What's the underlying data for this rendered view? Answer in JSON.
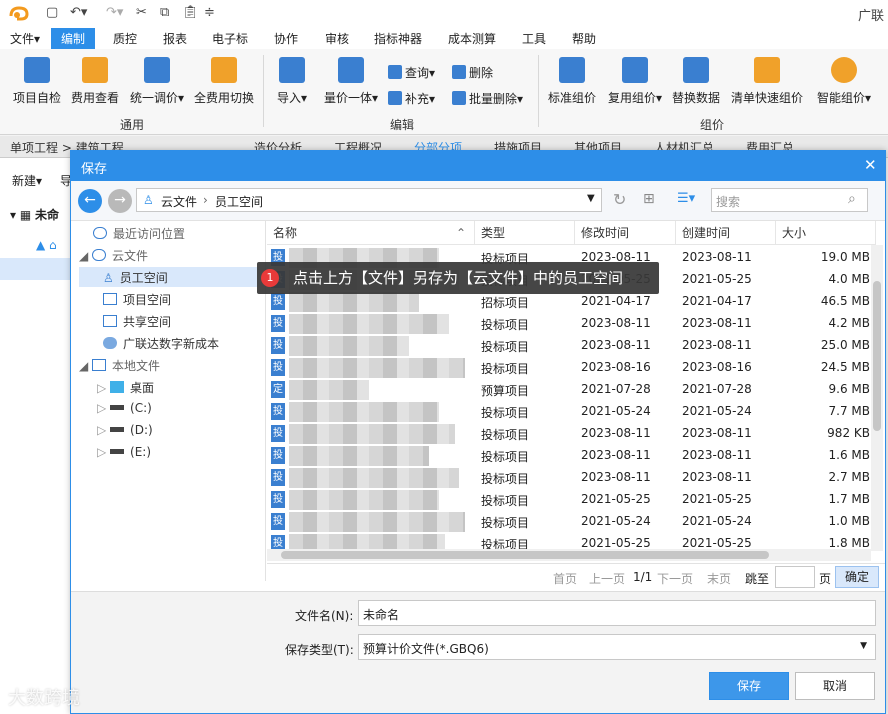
{
  "window": {
    "title_right": "广联达"
  },
  "menubar": [
    "文件",
    "编制",
    "质控",
    "报表",
    "电子标",
    "协作",
    "审核",
    "指标神器",
    "成本测算",
    "工具",
    "帮助"
  ],
  "ribbon": {
    "big_buttons_left": [
      "项目自检",
      "费用查看",
      "统一调价",
      "全费用切换"
    ],
    "big_buttons_mid": [
      "导入",
      "量价一体"
    ],
    "small_buttons": [
      "查询",
      "删除",
      "补充",
      "批量删除"
    ],
    "big_buttons_right": [
      "标准组价",
      "复用组价",
      "替换数据",
      "清单快速组价",
      "智能组价"
    ],
    "groups": [
      "通用",
      "编辑",
      "组价"
    ]
  },
  "background": {
    "tabs": [
      "单项工程",
      "建筑工程",
      "造价分析",
      "工程概况",
      "分部分项",
      "措施项目",
      "其他项目",
      "人材机汇总",
      "费用汇总"
    ],
    "toolbar": [
      "新建",
      "导"
    ],
    "tree": [
      "未命",
      "▲"
    ]
  },
  "dialog": {
    "title": "保存",
    "address": {
      "root": "云文件",
      "separator": "›",
      "current": "员工空间"
    },
    "search_placeholder": "搜索",
    "nav": [
      {
        "label": "最近访问位置",
        "icon": "clock-icon"
      },
      {
        "label": "云文件",
        "icon": "cloud-icon"
      },
      {
        "label": "员工空间",
        "icon": "user-icon"
      },
      {
        "label": "项目空间",
        "icon": "grid-icon"
      },
      {
        "label": "共享空间",
        "icon": "share-icon"
      },
      {
        "label": "广联达数字新成本",
        "icon": "gear-icon"
      },
      {
        "label": "本地文件",
        "icon": "computer-icon"
      },
      {
        "label": "桌面",
        "icon": "desktop-icon"
      },
      {
        "label": "(C:)",
        "icon": "drive-icon"
      },
      {
        "label": "(D:)",
        "icon": "drive-icon"
      },
      {
        "label": "(E:)",
        "icon": "drive-icon"
      }
    ],
    "columns": {
      "name": "名称",
      "type": "类型",
      "modified": "修改时间",
      "created": "创建时间",
      "size": "大小"
    },
    "files": [
      {
        "icon": "投",
        "type": "投标项目",
        "modified": "2023-08-11",
        "created": "2023-08-11",
        "size": "19.0 MB"
      },
      {
        "icon": "投",
        "type": "投标项目",
        "modified": "2021-05-25",
        "created": "2021-05-25",
        "size": "4.0 MB"
      },
      {
        "icon": "投",
        "type": "招标项目",
        "modified": "2021-04-17",
        "created": "2021-04-17",
        "size": "46.5 MB"
      },
      {
        "icon": "投",
        "type": "投标项目",
        "modified": "2023-08-11",
        "created": "2023-08-11",
        "size": "4.2 MB"
      },
      {
        "icon": "投",
        "type": "投标项目",
        "modified": "2023-08-11",
        "created": "2023-08-11",
        "size": "25.0 MB"
      },
      {
        "icon": "投",
        "type": "投标项目",
        "modified": "2023-08-16",
        "created": "2023-08-16",
        "size": "24.5 MB"
      },
      {
        "icon": "定",
        "type": "预算项目",
        "modified": "2021-07-28",
        "created": "2021-07-28",
        "size": "9.6 MB"
      },
      {
        "icon": "投",
        "type": "投标项目",
        "modified": "2021-05-24",
        "created": "2021-05-24",
        "size": "7.7 MB"
      },
      {
        "icon": "投",
        "type": "投标项目",
        "modified": "2023-08-11",
        "created": "2023-08-11",
        "size": "982 KB"
      },
      {
        "icon": "投",
        "type": "投标项目",
        "modified": "2023-08-11",
        "created": "2023-08-11",
        "size": "1.6 MB"
      },
      {
        "icon": "投",
        "type": "投标项目",
        "modified": "2023-08-11",
        "created": "2023-08-11",
        "size": "2.7 MB"
      },
      {
        "icon": "投",
        "type": "投标项目",
        "modified": "2021-05-25",
        "created": "2021-05-25",
        "size": "1.7 MB"
      },
      {
        "icon": "投",
        "type": "投标项目",
        "modified": "2021-05-24",
        "created": "2021-05-24",
        "size": "1.0 MB"
      },
      {
        "icon": "投",
        "type": "投标项目",
        "modified": "2021-05-25",
        "created": "2021-05-25",
        "size": "1.8 MB"
      }
    ],
    "pager": {
      "first": "首页",
      "prev": "上一页",
      "page": "1/1",
      "next": "下一页",
      "last": "末页",
      "goto": "跳至",
      "page_unit": "页",
      "confirm": "确定"
    },
    "filename_label": "文件名(N):",
    "filename_value": "未命名",
    "filetype_label": "保存类型(T):",
    "filetype_value": "预算计价文件(*.GBQ6)",
    "save_button": "保存",
    "cancel_button": "取消"
  },
  "callout": {
    "step": "1",
    "text": "点击上方【文件】另存为【云文件】中的员工空间"
  },
  "watermark": "大数跨境",
  "colors": {
    "accent": "#2d8ee8",
    "file_icon": "#3a7fd0",
    "badge": "#e83a3a"
  }
}
